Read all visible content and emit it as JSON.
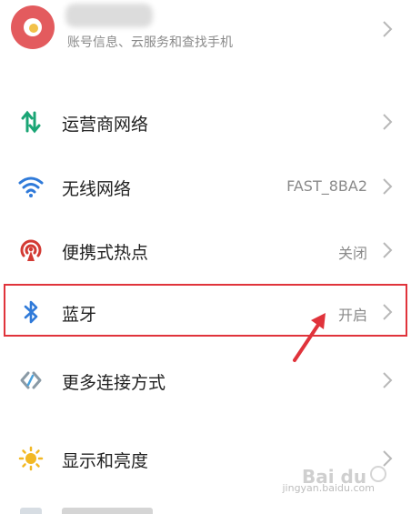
{
  "account": {
    "subtitle": "账号信息、云服务和查找手机"
  },
  "settings": [
    {
      "label": "运营商网络",
      "value": "",
      "icon": "mobile-data-icon",
      "color": "#1aa575"
    },
    {
      "label": "无线网络",
      "value": "FAST_8BA2",
      "icon": "wifi-icon",
      "color": "#2f7ad9"
    },
    {
      "label": "便携式热点",
      "value": "关闭",
      "icon": "hotspot-icon",
      "color": "#d33a33"
    },
    {
      "label": "蓝牙",
      "value": "开启",
      "icon": "bluetooth-icon",
      "color": "#2f7ad9"
    },
    {
      "label": "更多连接方式",
      "value": "",
      "icon": "link-icon",
      "color": "#8a9aa6"
    },
    {
      "label": "显示和亮度",
      "value": "",
      "icon": "sun-icon",
      "color": "#f2b824"
    }
  ],
  "colors": {
    "highlight": "#e0333b"
  },
  "watermark": {
    "logo": "Bai du",
    "sub": "jingyan.baidu.com"
  }
}
